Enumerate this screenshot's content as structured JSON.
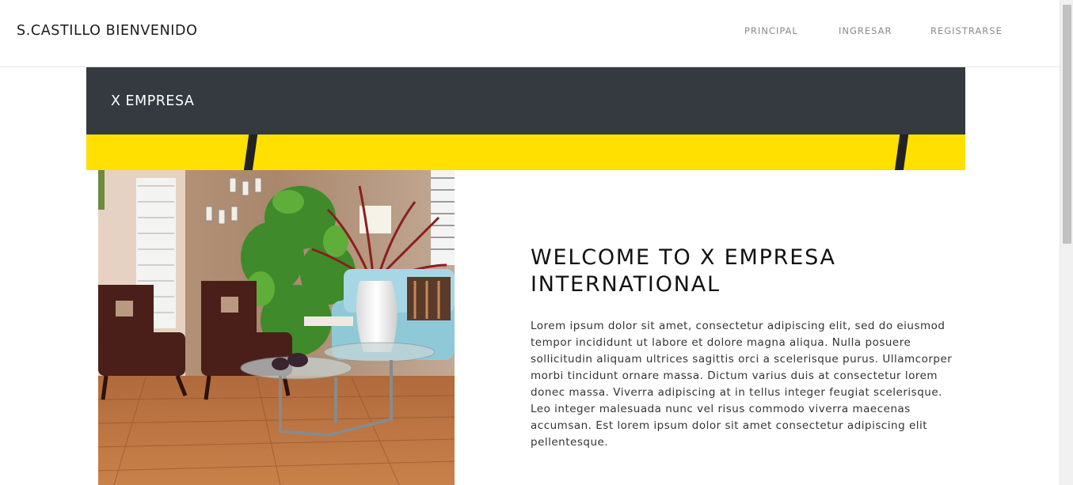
{
  "navbar": {
    "brand": "S.CASTILLO BIENVENIDO",
    "links": [
      "PRINCIPAL",
      "INGRESAR",
      "REGISTRARSE"
    ]
  },
  "hero": {
    "company_name": "X EMPRESA",
    "accent_color": "#ffe000",
    "band_color": "#343a40"
  },
  "welcome": {
    "title": "WELCOME TO X EMPRESA INTERNATIONAL",
    "body": "Lorem ipsum dolor sit amet, consectetur adipiscing elit, sed do eiusmod tempor incididunt ut labore et dolore magna aliqua. Nulla posuere sollicitudin aliquam ultrices sagittis orci a scelerisque purus. Ullamcorper morbi tincidunt ornare massa. Dictum varius duis at consectetur lorem donec massa. Viverra adipiscing at in tellus integer feugiat scelerisque. Leo integer malesuada nunc vel risus commodo viverra maecenas accumsan. Est lorem ipsum dolor sit amet consectetur adipiscing elit pellentesque."
  }
}
